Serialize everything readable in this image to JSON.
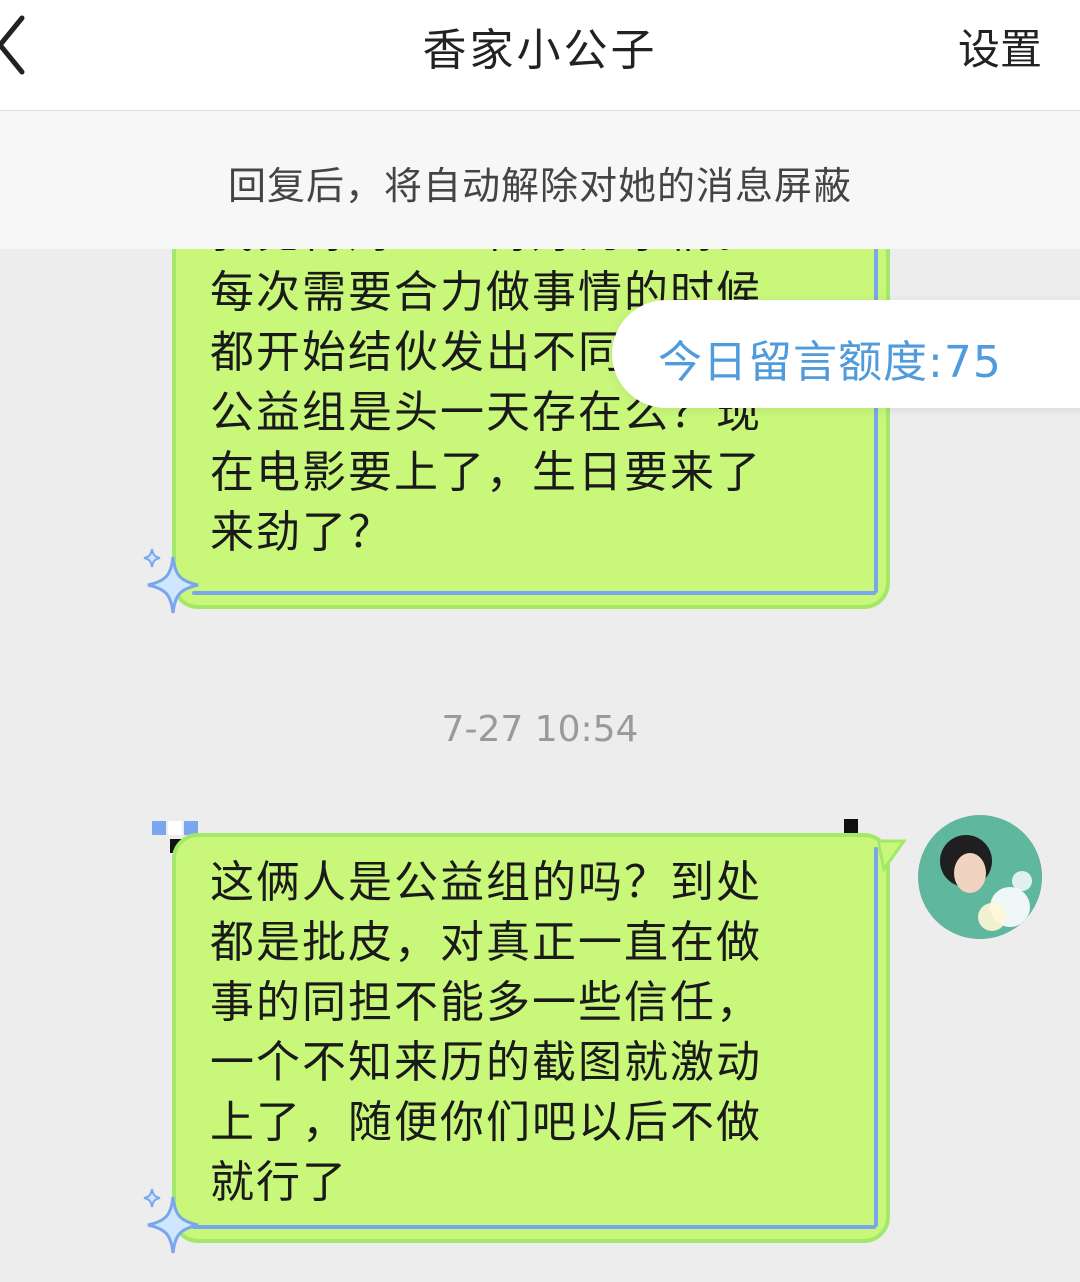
{
  "header": {
    "title": "香家小公子",
    "settings_label": "设置"
  },
  "notice": {
    "text": "回复后，将自动解除对她的消息屏蔽"
  },
  "quota": {
    "text": "今日留言额度:75"
  },
  "messages": [
    {
      "lines": [
        "我觉得对王一博好的事情。",
        "每次需要合力做事情的时候",
        "都开始结伙发出不同声音",
        "公益组是头一天存在么？现",
        "在电影要上了，生日要来了",
        "来劲了？"
      ]
    },
    {
      "lines": [
        "这俩人是公益组的吗？到处",
        "都是批皮，对真正一直在做",
        "事的同担不能多一些信任，",
        "一个不知来历的截图就激动",
        "上了，随便你们吧以后不做",
        "就行了"
      ]
    }
  ],
  "timestamp": "7-27 10:54",
  "icons": {
    "back": "chevron-left-icon",
    "sparkle": "sparkle-icon"
  },
  "colors": {
    "bubble": "#c9f77a",
    "bubble_border": "#a4e86a",
    "bubble_inner_line": "#79a6ee",
    "quota_text": "#4f9bdc"
  }
}
